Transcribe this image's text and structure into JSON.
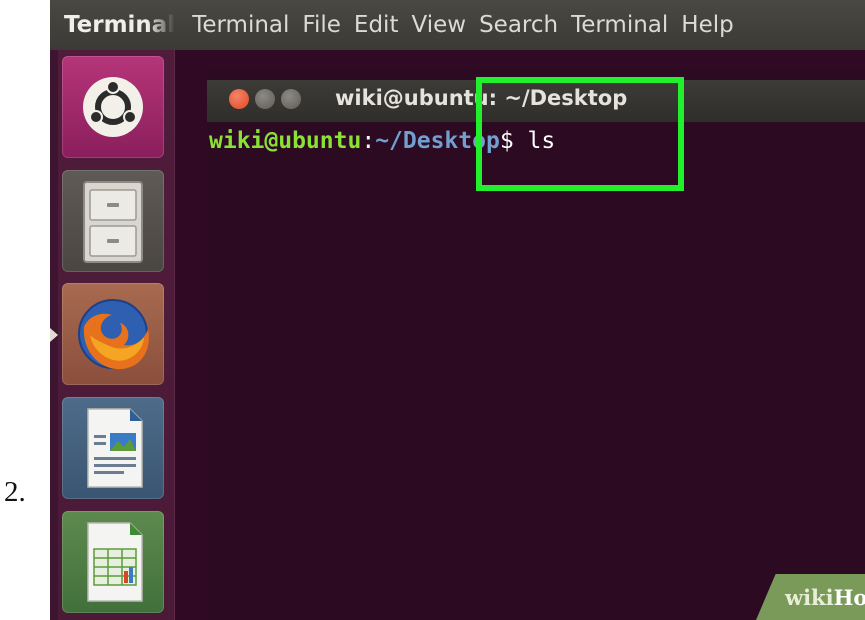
{
  "step_number": "2.",
  "menubar": {
    "app_title": "Terminal",
    "items": [
      "Terminal",
      "File",
      "Edit",
      "View",
      "Search",
      "Terminal",
      "Help"
    ]
  },
  "launcher": {
    "items": [
      {
        "icon": "ubuntu-dash-icon"
      },
      {
        "icon": "files-icon"
      },
      {
        "icon": "firefox-icon"
      },
      {
        "icon": "libreoffice-writer-icon"
      },
      {
        "icon": "libreoffice-calc-icon"
      }
    ],
    "active_item": "firefox-icon"
  },
  "terminal": {
    "title": "wiki@ubuntu: ~/Desktop",
    "prompt_user": "wiki@ubuntu",
    "prompt_sep": ":",
    "prompt_path": "~/Desktop",
    "prompt_dollar": "$",
    "command": " ls"
  },
  "watermark": {
    "part1": "wiki",
    "part2": "How"
  },
  "colors": {
    "terminal_bg": "#2c0a22",
    "prompt_user": "#8ae234",
    "prompt_path": "#729fcf",
    "highlight_box": "#22f02c",
    "launcher_bg": "#4f1d3b"
  }
}
